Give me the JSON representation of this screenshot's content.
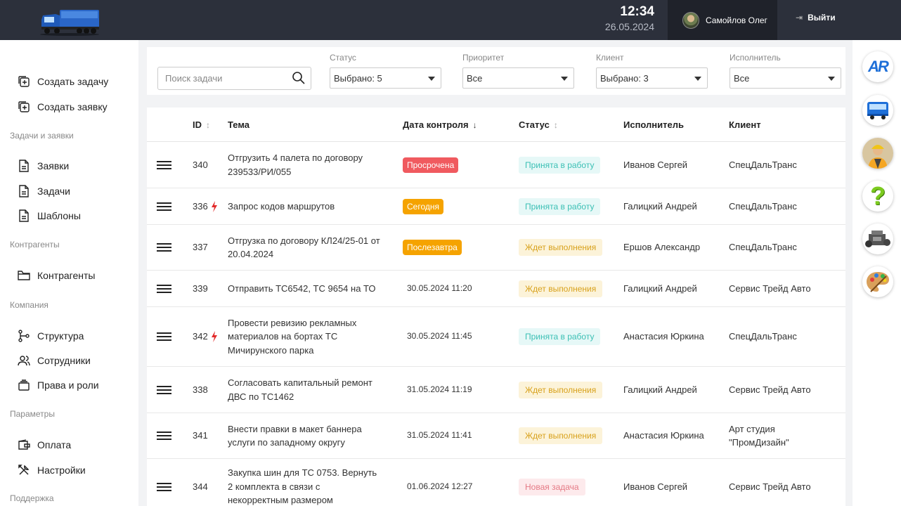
{
  "header": {
    "time": "12:34",
    "date": "26.05.2024",
    "user_name": "Самойлов Олег",
    "logout_label": "Выйти"
  },
  "sidebar": {
    "create_task": "Создать задачу",
    "create_request": "Создать заявку",
    "sections": {
      "tasks": "Задачи и заявки",
      "counterparties": "Контрагенты",
      "company": "Компания",
      "parameters": "Параметры",
      "support": "Поддержка"
    },
    "items": {
      "requests": "Заявки",
      "tasks": "Задачи",
      "templates": "Шаблоны",
      "counterparties": "Контрагенты",
      "structure": "Структура",
      "employees": "Сотрудники",
      "rights": "Права и роли",
      "payment": "Оплата",
      "settings": "Настройки"
    }
  },
  "filters": {
    "search_placeholder": "Поиск задачи",
    "status_label": "Статус",
    "status_value": "Выбрано: 5",
    "priority_label": "Приоритет",
    "priority_value": "Все",
    "client_label": "Клиент",
    "client_value": "Выбрано: 3",
    "executor_label": "Исполнитель",
    "executor_value": "Все"
  },
  "table": {
    "columns": {
      "id": "ID",
      "topic": "Тема",
      "control_date": "Дата контроля",
      "status": "Статус",
      "executor": "Исполнитель",
      "client": "Клиент"
    },
    "sort_icons": {
      "neutral": "↕",
      "desc": "↓"
    },
    "colors": {
      "overdue": "#f05a5f",
      "today": "#f5a300",
      "after_tomorrow": "#f5a300",
      "in_work_bg": "#e6f8f7",
      "in_work_fg": "#3cc0b5",
      "waiting_bg": "#fcf3d9",
      "waiting_fg": "#d8a11b",
      "new_bg": "#fdeaec",
      "new_fg": "#e57a85",
      "urgent_icon": "#e22a2a"
    },
    "rows": [
      {
        "id": "340",
        "urgent": false,
        "topic": "Отгрузить 4 палета по договору 239533/РИ/055",
        "date_badge": "Просрочена",
        "date_kind": "overdue",
        "status": "Принята в работу",
        "status_kind": "in_work",
        "executor": "Иванов Сергей",
        "client": "СпецДальТранс"
      },
      {
        "id": "336",
        "urgent": true,
        "topic": "Запрос кодов маршрутов",
        "date_badge": "Сегодня",
        "date_kind": "today",
        "status": "Принята в работу",
        "status_kind": "in_work",
        "executor": "Галицкий Андрей",
        "client": "СпецДальТранс"
      },
      {
        "id": "337",
        "urgent": false,
        "topic": "Отгрузка по договору КЛ24/25-01 от 20.04.2024",
        "date_badge": "Послезавтра",
        "date_kind": "after_tomorrow",
        "status": "Ждет выполнения",
        "status_kind": "waiting",
        "executor": "Ершов Александр",
        "client": "СпецДальТранс"
      },
      {
        "id": "339",
        "urgent": false,
        "topic": "Отправить ТС6542, ТС 9654 на ТО",
        "date_text": "30.05.2024 11:20",
        "status": "Ждет выполнения",
        "status_kind": "waiting",
        "executor": "Галицкий Андрей",
        "client": "Сервис Трейд Авто"
      },
      {
        "id": "342",
        "urgent": true,
        "topic": "Провести ревизию рекламных материалов на бортах ТС Мичирунского парка",
        "date_text": "30.05.2024 11:45",
        "status": "Принята в работу",
        "status_kind": "in_work",
        "executor": "Анастасия Юркина",
        "client": "СпецДальТранс"
      },
      {
        "id": "338",
        "urgent": false,
        "topic": "Согласовать капитальный ремонт ДВС по ТС1462",
        "date_text": "31.05.2024 11:19",
        "status": "Ждет выполнения",
        "status_kind": "waiting",
        "executor": "Галицкий Андрей",
        "client": "Сервис Трейд Авто"
      },
      {
        "id": "341",
        "urgent": false,
        "topic": "Внести правки в макет баннера услуги по западному округу",
        "date_text": "31.05.2024 11:41",
        "status": "Ждет выполнения",
        "status_kind": "waiting",
        "executor": "Анастасия Юркина",
        "client": "Арт студия \"ПромДизайн\""
      },
      {
        "id": "344",
        "urgent": false,
        "topic": "Закупка шин для ТС 0753. Вернуть 2 комплекта в связи с некорректным размером",
        "date_text": "01.06.2024 12:27",
        "status": "Новая задача",
        "status_kind": "new",
        "executor": "Иванов Сергей",
        "client": "Сервис Трейд Авто"
      }
    ]
  },
  "right_rail": {
    "icons": [
      "ar-logo-icon",
      "truck-icon",
      "worker-icon",
      "question-icon",
      "engine-icon",
      "palette-icon"
    ],
    "ar_text": "AR"
  }
}
